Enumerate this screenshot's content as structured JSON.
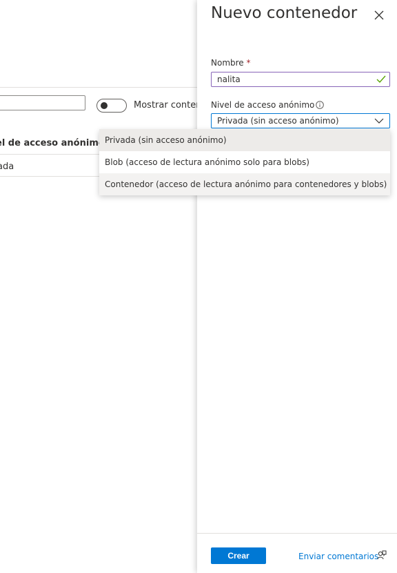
{
  "background": {
    "toggle_label": "Mostrar contene",
    "column_header": "el de acceso anónimo",
    "cell_value": "ada"
  },
  "panel": {
    "title": "Nuevo contenedor",
    "name_label": "Nombre",
    "name_required_mark": "*",
    "name_value": "nalita",
    "access_label": "Nivel de acceso anónimo",
    "access_value": "Privada (sin acceso anónimo)",
    "create_label": "Crear",
    "feedback_label": "Enviar comentarios"
  },
  "dropdown": {
    "options": [
      "Privada (sin acceso anónimo)",
      "Blob (acceso de lectura anónimo solo para blobs)",
      "Contenedor (acceso de lectura anónimo para contenedores y blobs)"
    ],
    "selected_index": 0
  },
  "colors": {
    "accent": "#0078d4",
    "input_border_valid": "#8764b8",
    "check": "#57a300",
    "required": "#a4262c"
  },
  "icons": [
    "close-icon",
    "checkmark-icon",
    "info-icon",
    "chevron-down-icon",
    "feedback-icon"
  ]
}
